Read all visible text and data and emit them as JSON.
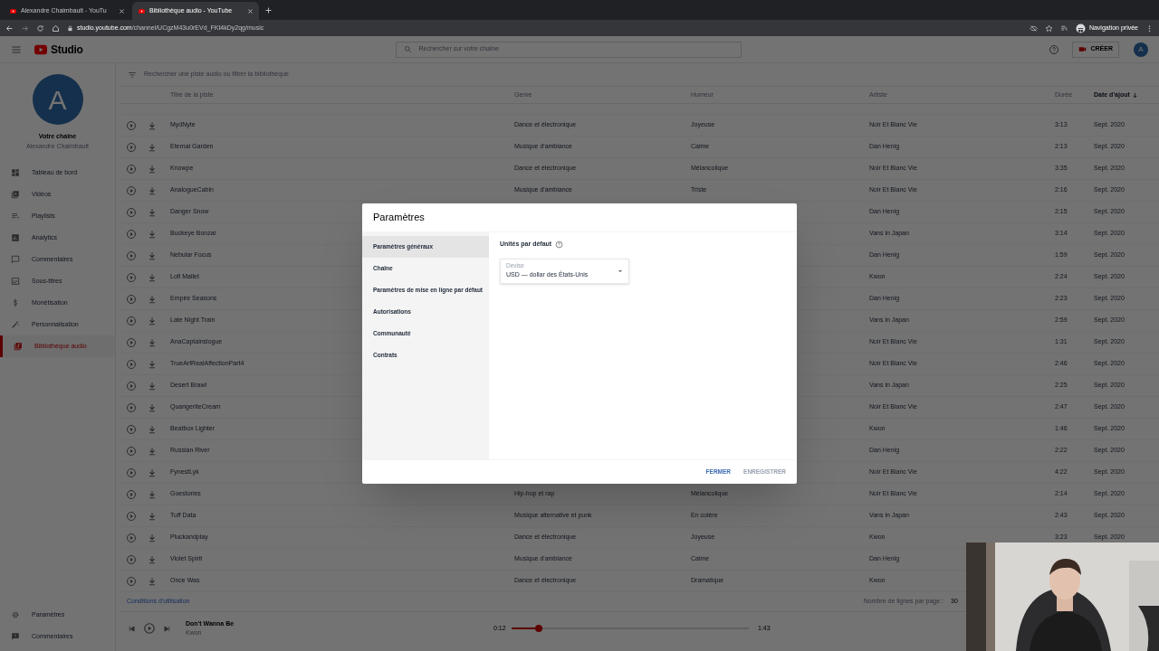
{
  "browser": {
    "tabs": [
      {
        "title": "Alexandre Chaimbault - YouTu",
        "selected": false
      },
      {
        "title": "Bibliothèque audio - YouTube",
        "selected": true
      }
    ],
    "url": {
      "host": "studio.youtube.com",
      "path": "/channel/UCgzM43u0rEVd_FKt4kDy2qg/music"
    },
    "profile": "Navigation privée"
  },
  "header": {
    "logo_text": "Studio",
    "search_placeholder": "Rechercher sur votre chaîne",
    "create_button": "CRÉER",
    "avatar_letter": "A"
  },
  "sidebar": {
    "avatar_letter": "A",
    "channel_title": "Votre chaîne",
    "channel_name": "Alexandre Chaimbault",
    "items": [
      {
        "label": "Tableau de bord",
        "selected": false
      },
      {
        "label": "Vidéos",
        "selected": false
      },
      {
        "label": "Playlists",
        "selected": false
      },
      {
        "label": "Analytics",
        "selected": false
      },
      {
        "label": "Commentaires",
        "selected": false
      },
      {
        "label": "Sous-titres",
        "selected": false
      },
      {
        "label": "Monétisation",
        "selected": false
      },
      {
        "label": "Personnalisation",
        "selected": false
      },
      {
        "label": "Bibliothèque audio",
        "selected": true
      }
    ],
    "bottom_items": [
      {
        "label": "Paramètres"
      },
      {
        "label": "Commentaires"
      }
    ]
  },
  "library": {
    "filter_placeholder": "Rechercher une piste audio ou filtrer la bibliothèque",
    "columns": [
      {
        "label": "Titre de la piste",
        "sorted": false
      },
      {
        "label": "Genre",
        "sorted": false
      },
      {
        "label": "Humeur",
        "sorted": false
      },
      {
        "label": "Artiste",
        "sorted": false
      },
      {
        "label": "Durée",
        "sorted": false
      },
      {
        "label": "Date d'ajout",
        "sorted": true
      }
    ],
    "rows": [
      {
        "title": "MydNyte",
        "genre": "Dance et électronique",
        "mood": "Joyeuse",
        "artist": "Noir Et Blanc Vie",
        "duration": "3:13",
        "date": "Sept. 2020"
      },
      {
        "title": "Eternal Garden",
        "genre": "Musique d'ambiance",
        "mood": "Calme",
        "artist": "Dan Henig",
        "duration": "2:13",
        "date": "Sept. 2020"
      },
      {
        "title": "Knowpe",
        "genre": "Dance et électronique",
        "mood": "Mélancolique",
        "artist": "Noir Et Blanc Vie",
        "duration": "3:35",
        "date": "Sept. 2020"
      },
      {
        "title": "AnalogueCabin",
        "genre": "Musique d'ambiance",
        "mood": "Triste",
        "artist": "Noir Et Blanc Vie",
        "duration": "2:16",
        "date": "Sept. 2020"
      },
      {
        "title": "Danger Snow",
        "artist": "Dan Henig",
        "duration": "2:15",
        "date": "Sept. 2020"
      },
      {
        "title": "Buckeye Bonzai",
        "artist": "Vans in Japan",
        "duration": "3:14",
        "date": "Sept. 2020"
      },
      {
        "title": "Nebular Focus",
        "artist": "Dan Henig",
        "duration": "1:59",
        "date": "Sept. 2020"
      },
      {
        "title": "Lofi Mallet",
        "artist": "Kwon",
        "duration": "2:24",
        "date": "Sept. 2020"
      },
      {
        "title": "Empire Seasons",
        "artist": "Dan Henig",
        "duration": "2:23",
        "date": "Sept. 2020"
      },
      {
        "title": "Late Night Train",
        "artist": "Vans in Japan",
        "duration": "2:59",
        "date": "Sept. 2020"
      },
      {
        "title": "AnaCaptainslogue",
        "artist": "Noir Et Blanc Vie",
        "duration": "1:31",
        "date": "Sept. 2020"
      },
      {
        "title": "TrueArtRealAffectionPart4",
        "artist": "Noir Et Blanc Vie",
        "duration": "2:46",
        "date": "Sept. 2020"
      },
      {
        "title": "Desert Brawl",
        "artist": "Vans in Japan",
        "duration": "2:25",
        "date": "Sept. 2020"
      },
      {
        "title": "QuangeriteCream",
        "artist": "Noir Et Blanc Vie",
        "duration": "2:47",
        "date": "Sept. 2020"
      },
      {
        "title": "Beatbox Lighter",
        "artist": "Kwon",
        "duration": "1:46",
        "date": "Sept. 2020"
      },
      {
        "title": "Russian River",
        "artist": "Dan Henig",
        "duration": "2:22",
        "date": "Sept. 2020"
      },
      {
        "title": "FynestLyk",
        "artist": "Noir Et Blanc Vie",
        "duration": "4:22",
        "date": "Sept. 2020"
      },
      {
        "title": "Goestories",
        "genre": "Hip-hop et rap",
        "mood": "Mélancolique",
        "artist": "Noir Et Blanc Vie",
        "duration": "2:14",
        "date": "Sept. 2020"
      },
      {
        "title": "Tuff Data",
        "genre": "Musique alternative et punk",
        "mood": "En colère",
        "artist": "Vans in Japan",
        "duration": "2:43",
        "date": "Sept. 2020"
      },
      {
        "title": "Pluckandplay",
        "genre": "Dance et électronique",
        "mood": "Joyeuse",
        "artist": "Kwon",
        "duration": "3:23",
        "date": "Sept. 2020"
      },
      {
        "title": "Violet Spirit",
        "genre": "Musique d'ambiance",
        "mood": "Calme",
        "artist": "Dan Henig"
      },
      {
        "title": "Once Was",
        "genre": "Dance et électronique",
        "mood": "Dramatique",
        "artist": "Kwon"
      }
    ],
    "terms_link": "Conditions d'utilisation",
    "rows_per_page_label": "Nombre de lignes par page :",
    "rows_per_page": "30"
  },
  "player": {
    "title": "Don't Wanna Be",
    "artist": "Kwon",
    "elapsed": "0:12",
    "total": "1:43",
    "level": 0.115
  },
  "dialog": {
    "title": "Paramètres",
    "nav": [
      {
        "label": "Paramètres généraux",
        "selected": true
      },
      {
        "label": "Chaîne",
        "selected": false
      },
      {
        "label": "Paramètres de mise en ligne par défaut",
        "selected": false
      },
      {
        "label": "Autorisations",
        "selected": false
      },
      {
        "label": "Communauté",
        "selected": false
      },
      {
        "label": "Contrats",
        "selected": false
      }
    ],
    "section_title": "Unités par défaut",
    "field": {
      "label": "Devise",
      "value": "USD — dollar des États-Unis"
    },
    "buttons": [
      {
        "label": "FERMER",
        "disabled": false
      },
      {
        "label": "ENREGISTRER",
        "disabled": true
      }
    ]
  }
}
